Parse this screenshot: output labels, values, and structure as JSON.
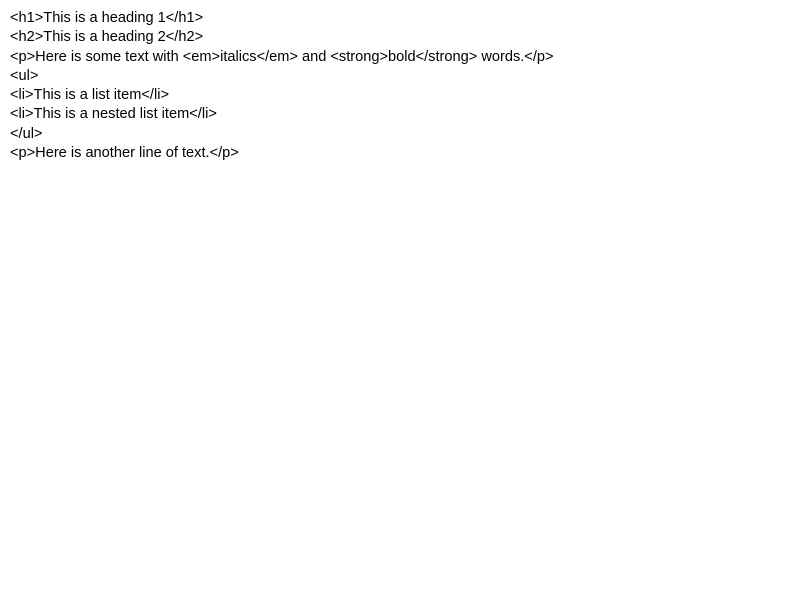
{
  "document": {
    "lines": [
      "<h1>This is a heading 1</h1>",
      "<h2>This is a heading 2</h2>",
      "<p>Here is some text with <em>italics</em> and <strong>bold</strong> words.</p>",
      "<ul>",
      "<li>This is a list item</li>",
      "<li>This is a nested list item</li>",
      "</ul>",
      "<p>Here is another line of text.</p>"
    ]
  },
  "colors": {
    "background": "#ffffff",
    "text": "#000000"
  }
}
